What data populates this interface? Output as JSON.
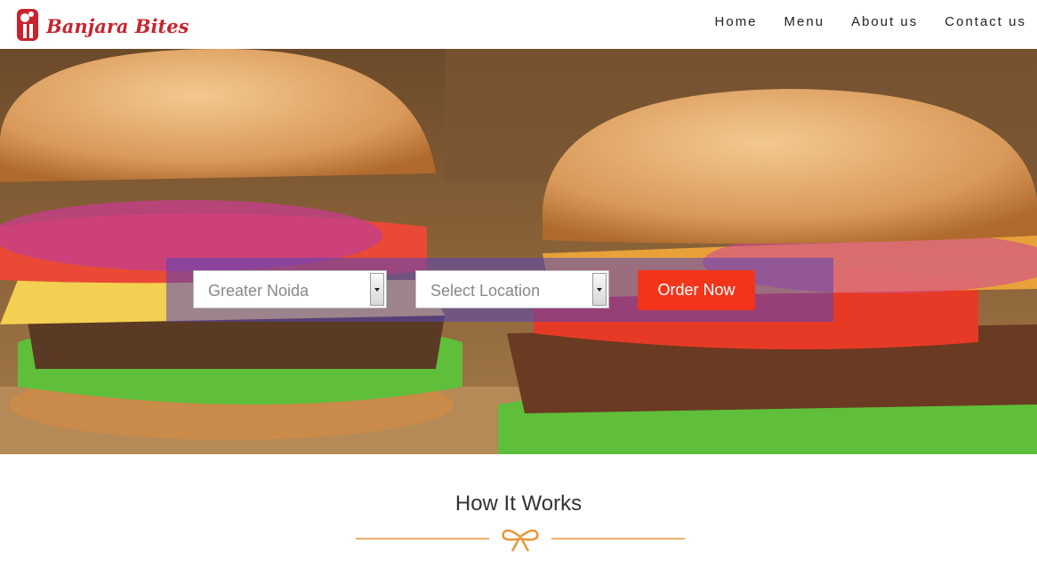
{
  "brand": {
    "name": "Banjara Bites",
    "color": "#c8242f"
  },
  "nav": {
    "items": [
      {
        "label": "Home"
      },
      {
        "label": "Menu"
      },
      {
        "label": "About us"
      },
      {
        "label": "Contact us"
      }
    ]
  },
  "search": {
    "city_value": "Greater Noida",
    "location_placeholder": "Select Location",
    "order_label": "Order Now",
    "order_color": "#f2341b"
  },
  "carousel": {
    "slide_count": 6,
    "active_index": 0
  },
  "how_it_works": {
    "title": "How It Works",
    "divider_icon": "bow-icon",
    "accent": "#e9963a"
  }
}
